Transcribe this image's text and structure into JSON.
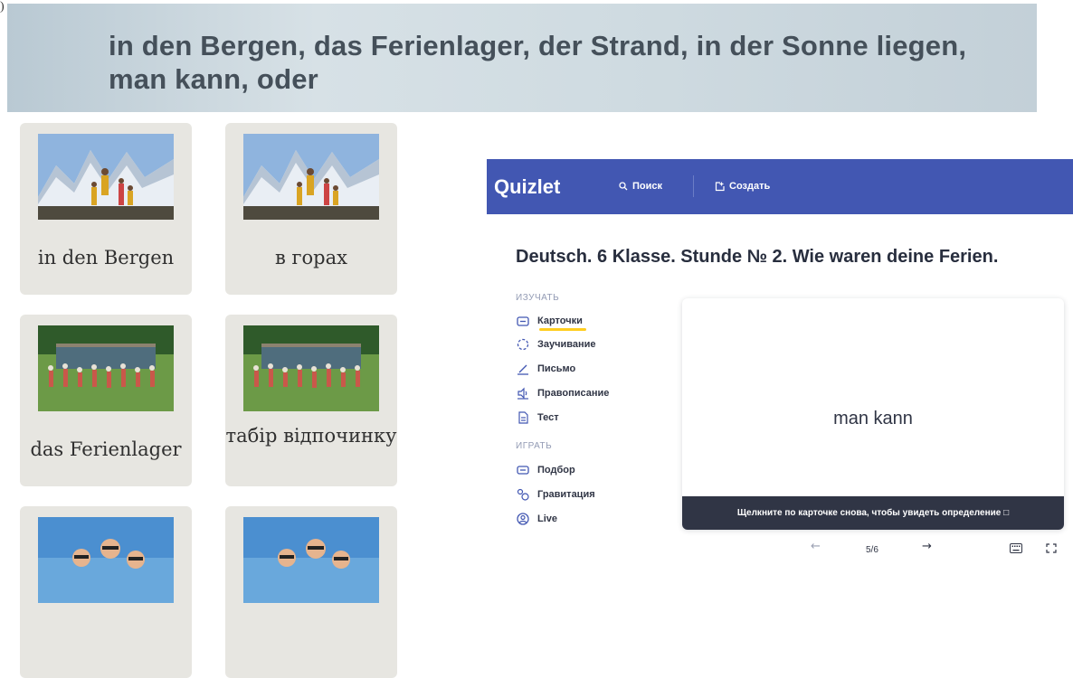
{
  "page_fragment": ")",
  "banner": {
    "line1": "in den Bergen, das Ferienlager, der Strand, in der Sonne liegen,",
    "line2": "man kann, oder"
  },
  "cards": [
    {
      "label": "in den Bergen",
      "image": "mountain-hikers-image"
    },
    {
      "label": "в горах",
      "image": "mountain-hikers-image"
    },
    {
      "label": "das Ferienlager",
      "image": "summer-camp-image"
    },
    {
      "label": "табір відпочинку",
      "image": "summer-camp-image"
    },
    {
      "label": "",
      "image": "beach-kids-image"
    },
    {
      "label": "",
      "image": "beach-kids-image"
    }
  ],
  "quizlet": {
    "logo": "Quizlet",
    "nav_search": "Поиск",
    "nav_create": "Создать",
    "title": "Deutsch. 6 Klasse. Stunde № 2. Wie waren deine Ferien.",
    "study_heading": "ИЗУЧАТЬ",
    "study_items": [
      "Карточки",
      "Заучивание",
      "Письмо",
      "Правописание",
      "Тест"
    ],
    "play_heading": "ИГРАТЬ",
    "play_items": [
      "Подбор",
      "Гравитация",
      "Live"
    ],
    "card_term": "man kann",
    "card_hint": "Щелкните по карточке снова, чтобы увидеть определение",
    "hint_icon": "□",
    "counter": "5/6",
    "colors": {
      "header": "#4257b2",
      "accent": "#ffcd1f",
      "dark": "#303545"
    }
  }
}
